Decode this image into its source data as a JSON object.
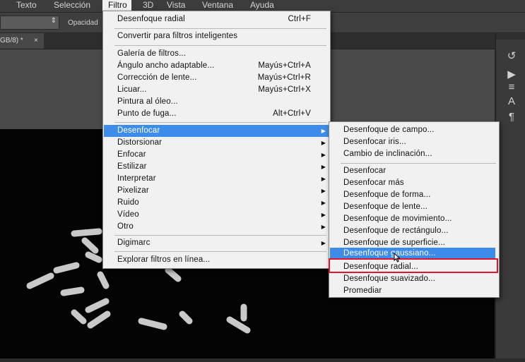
{
  "menubar": {
    "items": [
      "Texto",
      "Selección",
      "Filtro",
      "3D",
      "Vista",
      "Ventana",
      "Ayuda"
    ]
  },
  "options_bar": {
    "opacity_label": "Opacidad"
  },
  "document_tab": {
    "label": "GB/8) *",
    "close": "×"
  },
  "filter_menu": {
    "last_filter": {
      "label": "Desenfoque radial",
      "shortcut": "Ctrl+F"
    },
    "smart_filters": "Convertir para filtros inteligentes",
    "items_group1": [
      {
        "label": "Galería de filtros...",
        "shortcut": ""
      },
      {
        "label": "Ángulo ancho adaptable...",
        "shortcut": "Mayús+Ctrl+A"
      },
      {
        "label": "Corrección de lente...",
        "shortcut": "Mayús+Ctrl+R"
      },
      {
        "label": "Licuar...",
        "shortcut": "Mayús+Ctrl+X"
      },
      {
        "label": "Pintura al óleo...",
        "shortcut": ""
      },
      {
        "label": "Punto de fuga...",
        "shortcut": "Alt+Ctrl+V"
      }
    ],
    "submenus": [
      "Desenfocar",
      "Distorsionar",
      "Enfocar",
      "Estilizar",
      "Interpretar",
      "Pixelizar",
      "Ruido",
      "Vídeo",
      "Otro"
    ],
    "digimarc": "Digimarc",
    "browse": "Explorar filtros en línea...",
    "arrow": "▶"
  },
  "blur_submenu": {
    "group1": [
      "Desenfoque de campo...",
      "Desenfocar iris...",
      "Cambio de inclinación..."
    ],
    "group2": [
      "Desenfocar",
      "Desenfocar más",
      "Desenfoque de forma...",
      "Desenfoque de lente...",
      "Desenfoque de movimiento...",
      "Desenfoque de rectángulo...",
      "Desenfoque de superficie...",
      "Desenfoque gaussiano...",
      "Desenfoque radial...",
      "Desenfoque suavizado...",
      "Promediar"
    ],
    "highlighted": "Desenfoque gaussiano...",
    "outlined": "Desenfoque radial..."
  },
  "colors": {
    "highlight": "#3e8ce9",
    "outline": "#e0142a",
    "menu_bg": "#f1f1f1"
  }
}
